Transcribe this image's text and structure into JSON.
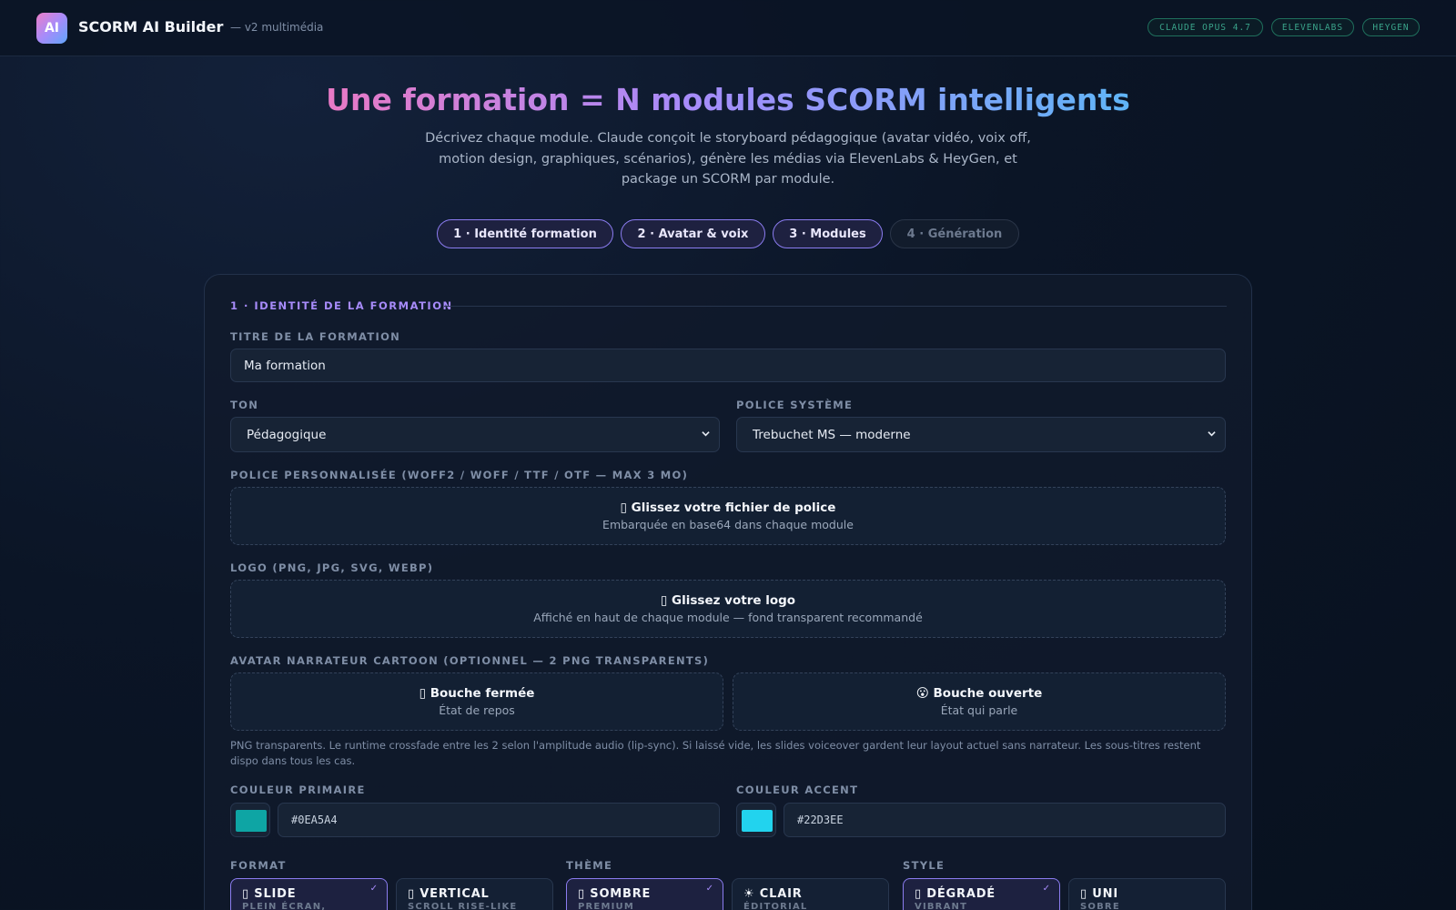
{
  "header": {
    "logo_text": "AI",
    "app_name": "SCORM AI Builder",
    "version": "— v2 multimédia",
    "badges": [
      "CLAUDE OPUS 4.7",
      "ELEVENLABS",
      "HEYGEN"
    ]
  },
  "hero": {
    "title": "Une formation = N modules SCORM intelligents",
    "subtitle": "Décrivez chaque module. Claude conçoit le storyboard pédagogique (avatar vidéo, voix off, motion design, graphiques, scénarios), génère les médias via ElevenLabs & HeyGen, et package un SCORM par module."
  },
  "steps": [
    {
      "label": "1 · Identité formation",
      "active": true
    },
    {
      "label": "2 · Avatar & voix",
      "active": true
    },
    {
      "label": "3 · Modules",
      "active": true
    },
    {
      "label": "4 · Génération",
      "active": false
    }
  ],
  "form": {
    "section_title": "1 · IDENTITÉ DE LA FORMATION",
    "title_label": "TITRE DE LA FORMATION",
    "title_value": "Ma formation",
    "tone_label": "TON",
    "tone_value": "Pédagogique",
    "font_label": "POLICE SYSTÈME",
    "font_value": "Trebuchet MS — moderne",
    "custom_font_label": "POLICE PERSONNALISÉE (WOFF2 / WOFF / TTF / OTF — MAX 3 MO)",
    "font_drop_title": "▯ Glissez votre fichier de police",
    "font_drop_sub": "Embarquée en base64 dans chaque module",
    "logo_label": "LOGO (PNG, JPG, SVG, WEBP)",
    "logo_drop_title": "▯ Glissez votre logo",
    "logo_drop_sub": "Affiché en haut de chaque module — fond transparent recommandé",
    "avatar_label": "AVATAR NARRATEUR CARTOON (OPTIONNEL — 2 PNG TRANSPARENTS)",
    "mouth_closed_title": "▯ Bouche fermée",
    "mouth_closed_sub": "État de repos",
    "mouth_open_title": "😮 Bouche ouverte",
    "mouth_open_sub": "État qui parle",
    "avatar_hint": "PNG transparents. Le runtime crossfade entre les 2 selon l'amplitude audio (lip-sync). Si laissé vide, les slides voiceover gardent leur layout actuel sans narrateur. Les sous-titres restent dispo dans tous les cas.",
    "primary_label": "COULEUR PRIMAIRE",
    "primary_value": "#0EA5A4",
    "accent_label": "COULEUR ACCENT",
    "accent_value": "#22D3EE",
    "format_label": "FORMAT",
    "theme_label": "THÈME",
    "style_label": "STYLE",
    "format_options": [
      {
        "title": "▯ SLIDE",
        "sub": "PLEIN ÉCRAN,",
        "selected": true
      },
      {
        "title": "▯ VERTICAL",
        "sub": "SCROLL RISE-LIKE",
        "selected": false
      }
    ],
    "theme_options": [
      {
        "title": "▯ SOMBRE",
        "sub": "PREMIUM",
        "selected": true
      },
      {
        "title": "☀ CLAIR",
        "sub": "ÉDITORIAL",
        "selected": false
      }
    ],
    "style_options": [
      {
        "title": "▯ DÉGRADÉ",
        "sub": "VIBRANT",
        "selected": true
      },
      {
        "title": "▯ UNI",
        "sub": "SOBRE",
        "selected": false
      }
    ],
    "check_mark": "✓"
  },
  "colors": {
    "primary": "#0EA5A4",
    "accent": "#22D3EE",
    "brand_purple": "#A78BFA"
  }
}
